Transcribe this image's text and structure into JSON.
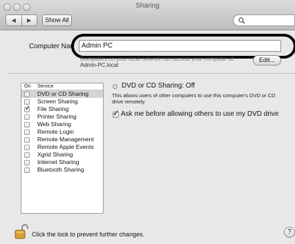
{
  "window": {
    "title": "Sharing",
    "back_glyph": "◀",
    "forward_glyph": "▶",
    "show_all_label": "Show All",
    "search": {
      "value": "",
      "icon": "search-icon"
    }
  },
  "computer_name": {
    "label": "Computer Nan",
    "value": "Admin PC",
    "description_line1": "Computers on your local network can access your computer at:",
    "description_line2": "Admin-PC.local",
    "edit_label": "Edit..."
  },
  "services": {
    "header_on": "On",
    "header_service": "Service",
    "items": [
      {
        "name": "DVD or CD Sharing",
        "on": false,
        "selected": true
      },
      {
        "name": "Screen Sharing",
        "on": false,
        "selected": false
      },
      {
        "name": "File Sharing",
        "on": true,
        "selected": false
      },
      {
        "name": "Printer Sharing",
        "on": false,
        "selected": false
      },
      {
        "name": "Web Sharing",
        "on": false,
        "selected": false
      },
      {
        "name": "Remote Login",
        "on": false,
        "selected": false
      },
      {
        "name": "Remote Management",
        "on": false,
        "selected": false
      },
      {
        "name": "Remote Apple Events",
        "on": false,
        "selected": false
      },
      {
        "name": "Xgrid Sharing",
        "on": false,
        "selected": false
      },
      {
        "name": "Internet Sharing",
        "on": false,
        "selected": false
      },
      {
        "name": "Bluetooth Sharing",
        "on": false,
        "selected": false
      }
    ]
  },
  "detail": {
    "status": "DVD or CD Sharing: Off",
    "description": "This allows users of other computers to use this computer's DVD or CD drive remotely.",
    "ask_checkbox_checked": true,
    "ask_label": "Ask me before allowing others to use my DVD drive"
  },
  "footer": {
    "lock_text": "Click the lock to prevent further changes.",
    "help_label": "?"
  },
  "colors": {
    "selection": "#d4d4d4",
    "window_bg": "#e8e8e8"
  }
}
